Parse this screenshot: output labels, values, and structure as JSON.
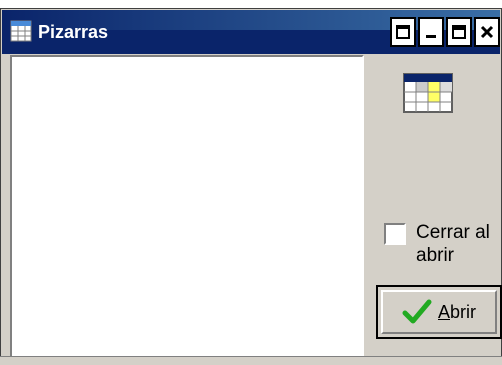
{
  "window": {
    "title": "Pizarras",
    "title_icon": "table-icon",
    "controls": [
      "restore-icon",
      "minimize-icon",
      "maximize-icon",
      "close-icon"
    ]
  },
  "list": {
    "items": []
  },
  "sidebar": {
    "icon": "table-icon",
    "checkbox": {
      "label_line1": "Cerrar al",
      "label_line2": "abrir",
      "checked": false
    },
    "open_button": {
      "label_first": "A",
      "label_rest": "brir",
      "icon": "checkmark-icon"
    }
  },
  "colors": {
    "titlebar": "#0a246a",
    "face": "#d4d0c8",
    "checkmark": "#22aa22",
    "table_header": "#0a246a",
    "table_highlight": "#ffff66"
  }
}
